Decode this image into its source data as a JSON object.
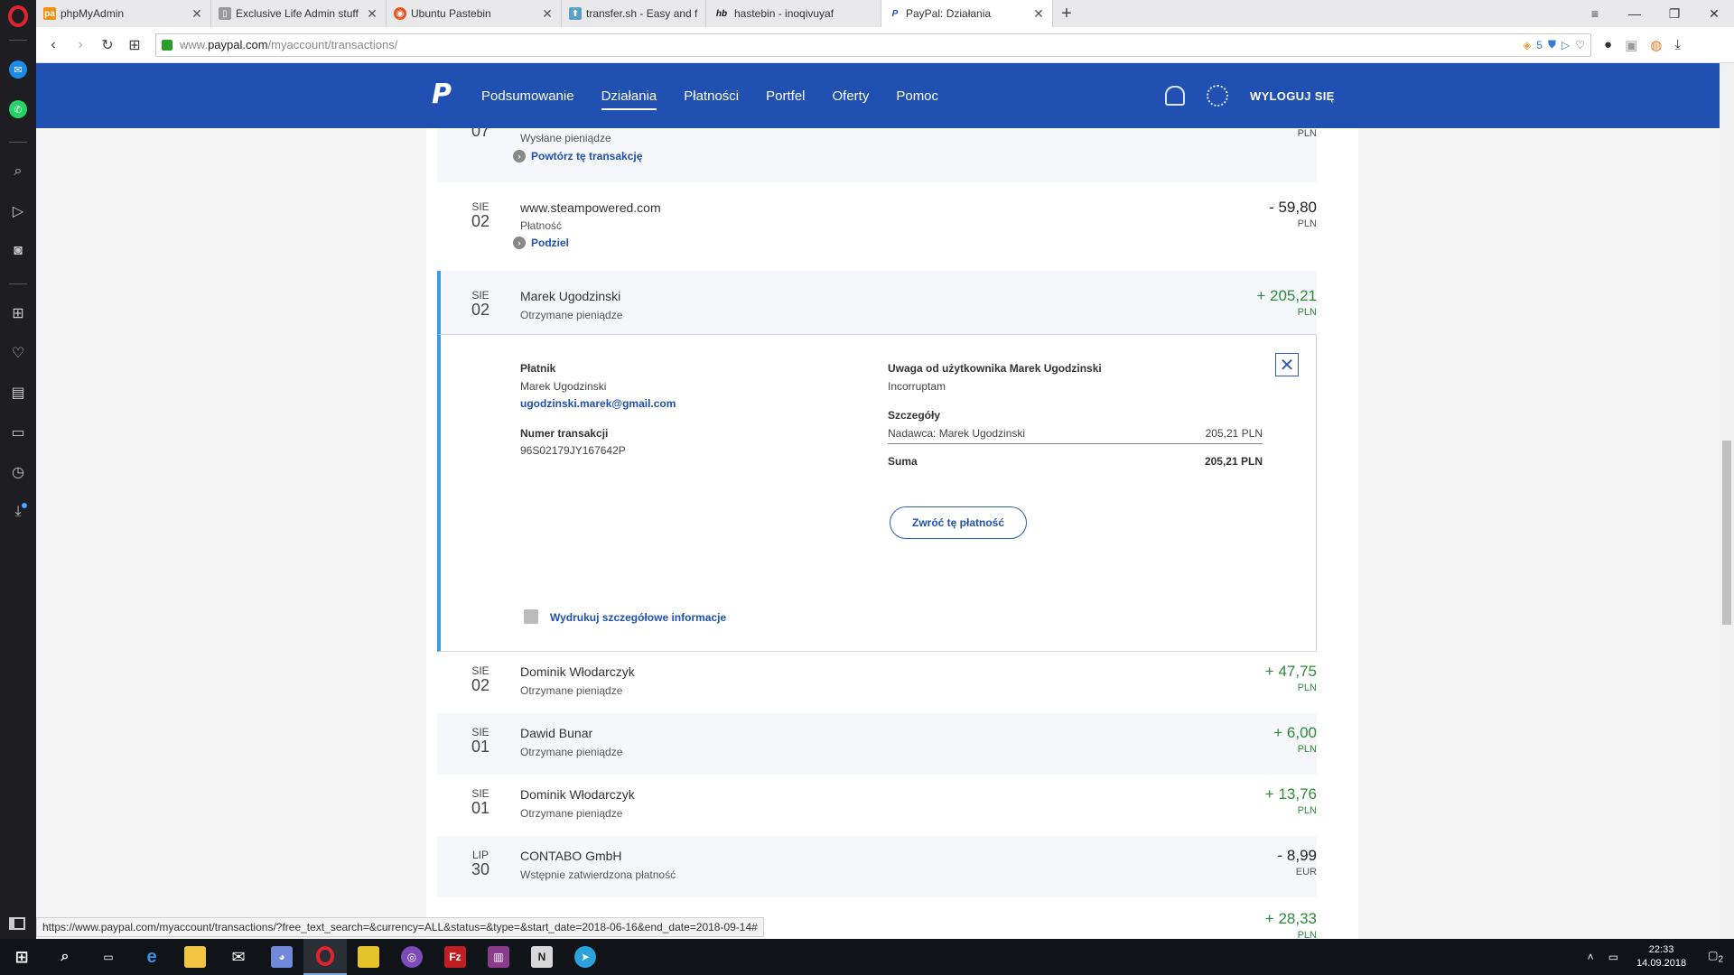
{
  "tabs": [
    {
      "label": "phpMyAdmin",
      "fav_color": "#f29111",
      "fav_text": "pa"
    },
    {
      "label": "Exclusive Life Admin stuff",
      "fav_color": "#888888",
      "fav_text": "▯"
    },
    {
      "label": "Ubuntu Pastebin",
      "fav_color": "#e95420",
      "fav_text": "◉"
    },
    {
      "label": "transfer.sh - Easy and fast",
      "fav_color": "#5aa0c8",
      "fav_text": "⬆"
    },
    {
      "label": "hastebin - inoqivuyaf",
      "fav_color": "#ffffff",
      "fav_text": "hb"
    },
    {
      "label": "PayPal: Działania",
      "fav_color": "#1f50b2",
      "fav_text": "P"
    }
  ],
  "address": {
    "prefix": "www.",
    "host": "paypal.com",
    "path": "/myaccount/transactions/",
    "badge": "5"
  },
  "header": {
    "nav": [
      "Podsumowanie",
      "Działania",
      "Płatności",
      "Portfel",
      "Oferty",
      "Pomoc"
    ],
    "active": "Działania",
    "logout": "WYLOGUJ SIĘ"
  },
  "transactions": {
    "top": {
      "day": "07",
      "desc": "Wysłane pieniądze",
      "action": "Powtórz tę transakcję",
      "currency": "PLN"
    },
    "steam": {
      "mon": "SIE",
      "day": "02",
      "name": "www.steampowered.com",
      "desc": "Płatność",
      "action": "Podziel",
      "amount": "- 59,80",
      "currency": "PLN"
    },
    "marek": {
      "mon": "SIE",
      "day": "02",
      "name": "Marek Ugodzinski",
      "desc": "Otrzymane pieniądze",
      "amount": "+ 205,21",
      "currency": "PLN"
    },
    "rows": [
      {
        "mon": "SIE",
        "day": "02",
        "name": "Dominik Włodarczyk",
        "desc": "Otrzymane pieniądze",
        "amount": "+ 47,75",
        "currency": "PLN",
        "positive": true
      },
      {
        "mon": "SIE",
        "day": "01",
        "name": "Dawid Bunar",
        "desc": "Otrzymane pieniądze",
        "amount": "+ 6,00",
        "currency": "PLN",
        "positive": true
      },
      {
        "mon": "SIE",
        "day": "01",
        "name": "Dominik Włodarczyk",
        "desc": "Otrzymane pieniądze",
        "amount": "+ 13,76",
        "currency": "PLN",
        "positive": true
      },
      {
        "mon": "LIP",
        "day": "30",
        "name": "CONTABO GmbH",
        "desc": "Wstępnie zatwierdzona płatność",
        "amount": "- 8,99",
        "currency": "EUR",
        "positive": false
      }
    ],
    "partial": {
      "amount": "+ 28,33",
      "currency": "PLN"
    }
  },
  "details": {
    "payer_label": "Płatnik",
    "payer_name": "Marek Ugodzinski",
    "payer_email": "ugodzinski.marek@gmail.com",
    "txn_label": "Numer transakcji",
    "txn_id": "96S02179JY167642P",
    "note_label": "Uwaga od użytkownika Marek Ugodzinski",
    "note_text": "Incorruptam",
    "details_label": "Szczegóły",
    "sender_line": "Nadawca: Marek Ugodzinski",
    "sender_amount": "205,21 PLN",
    "total_label": "Suma",
    "total_amount": "205,21 PLN",
    "refund_button": "Zwróć tę płatność",
    "print_link": "Wydrukuj szczegółowe informacje"
  },
  "status_url": "https://www.paypal.com/myaccount/transactions/?free_text_search=&currency=ALL&status=&type=&start_date=2018-06-16&end_date=2018-09-14#",
  "taskbar": {
    "time": "22:33",
    "date": "14.09.2018",
    "notif_count": "2"
  }
}
